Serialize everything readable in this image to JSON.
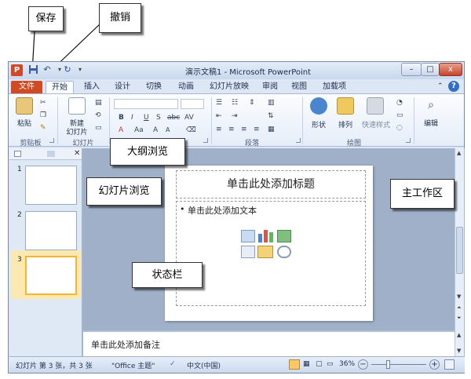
{
  "window": {
    "title": "演示文稿1 - Microsoft PowerPoint",
    "app_icon": "P",
    "controls": {
      "minimize": "–",
      "maximize": "□",
      "close": "x"
    }
  },
  "quick_access": {
    "save_icon": "save-icon",
    "undo_icon": "undo-icon",
    "redo_icon": "redo-icon"
  },
  "tabs": [
    "文件",
    "开始",
    "插入",
    "设计",
    "切换",
    "动画",
    "幻灯片放映",
    "审阅",
    "视图",
    "加载项"
  ],
  "ribbon": {
    "clipboard": {
      "label": "剪贴板",
      "paste": "粘贴"
    },
    "slides": {
      "label": "幻灯片",
      "new_slide_1": "新建",
      "new_slide_2": "幻灯片"
    },
    "font": {
      "bold": "B",
      "italic": "I",
      "underline": "U",
      "strike": "S",
      "abc": "abc",
      "av": "AV",
      "aa": "Aa",
      "grow": "A",
      "shrink": "A"
    },
    "paragraph": {
      "label": "段落"
    },
    "drawing": {
      "label": "绘图",
      "shapes": "形状",
      "arrange": "排列",
      "quick_styles": "快速样式"
    },
    "editing": {
      "edit": "编辑"
    }
  },
  "thumbnails": [
    {
      "number": "1"
    },
    {
      "number": "2"
    },
    {
      "number": "3",
      "selected": true
    }
  ],
  "slide": {
    "title_placeholder": "单击此处添加标题",
    "content_placeholder": "单击此处添加文本",
    "bullet": "•"
  },
  "notes": {
    "placeholder": "单击此处添加备注"
  },
  "statusbar": {
    "slide_info": "幻灯片 第 3 张，共 3 张",
    "theme": "\"Office 主题\"",
    "language": "中文(中国)",
    "zoom": "36%",
    "zoom_minus": "−",
    "zoom_plus": "+"
  },
  "callouts": {
    "save": "保存",
    "undo": "撤销",
    "outline": "大纲浏览",
    "slide_browse": "幻灯片浏览",
    "main_area": "主工作区",
    "statusbar": "状态栏"
  },
  "colors": {
    "file_tab": "#d04a22",
    "selected_thumb": "#f3b43a",
    "window_frame": "#dce6f4"
  }
}
